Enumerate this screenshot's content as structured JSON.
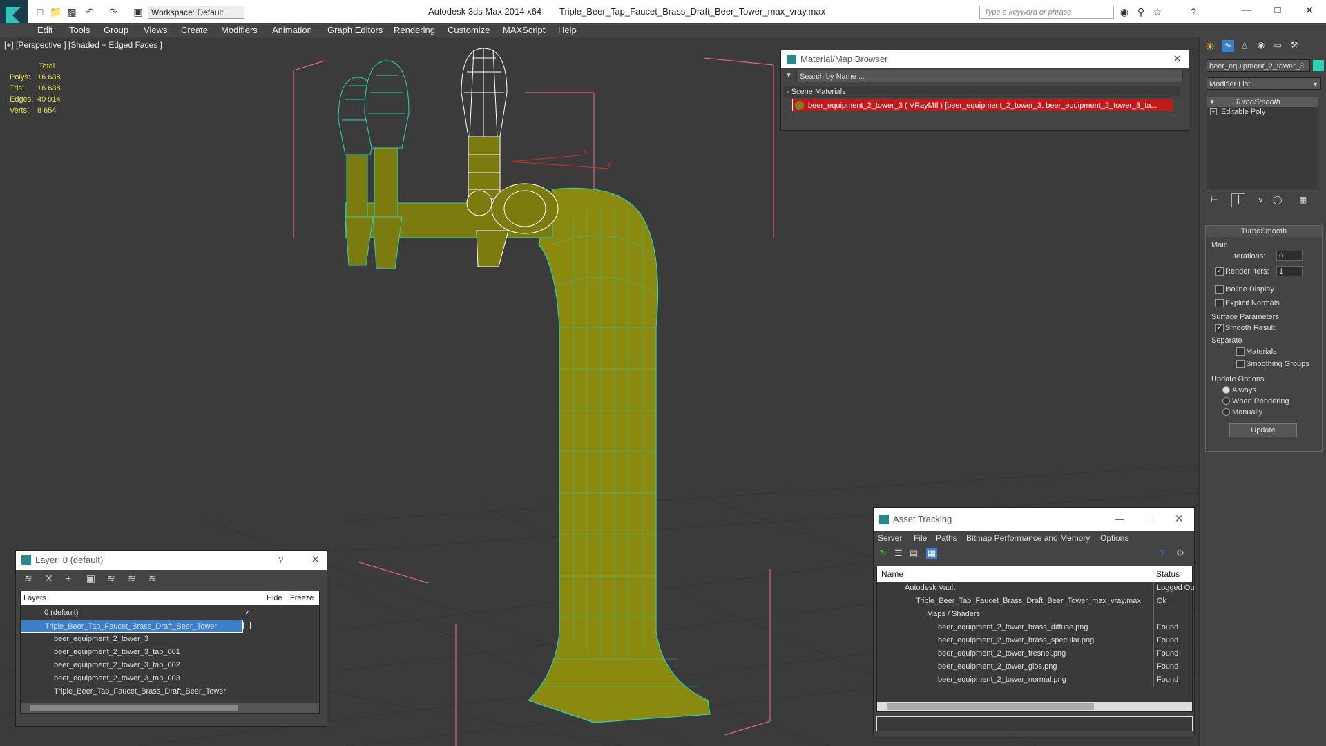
{
  "titlebar": {
    "app_title": "Autodesk 3ds Max  2014 x64",
    "file_title": "Triple_Beer_Tap_Faucet_Brass_Draft_Beer_Tower_max_vray.max",
    "workspace": "Workspace: Default",
    "search_placeholder": "Type a keyword or phrase"
  },
  "menu": [
    "Edit",
    "Tools",
    "Group",
    "Views",
    "Create",
    "Modifiers",
    "Animation",
    "Graph Editors",
    "Rendering",
    "Customize",
    "MAXScript",
    "Help"
  ],
  "viewport": {
    "label": "[+] [Perspective ] [Shaded + Edged Faces ]",
    "stats": {
      "total_label": "Total",
      "rows": [
        {
          "label": "Polys:",
          "value": "16 638"
        },
        {
          "label": "Tris:",
          "value": "16 638"
        },
        {
          "label": "Edges:",
          "value": "49 914"
        },
        {
          "label": "Verts:",
          "value": "8 654"
        }
      ]
    },
    "axis_x": "x",
    "axis_y": "y"
  },
  "material_browser": {
    "title": "Material/Map Browser",
    "search": "Search by Name ...",
    "section": "- Scene Materials",
    "item": "beer_equipment_2_tower_3  ( VRayMtl ) [beer_equipment_2_tower_3, beer_equipment_2_tower_3_ta..."
  },
  "command_panel": {
    "object_name": "beer_equipment_2_tower_3",
    "modifier_list": "Modifier List",
    "stack": [
      "TurboSmooth",
      "Editable Poly"
    ],
    "rollout_title": "TurboSmooth",
    "main_label": "Main",
    "iterations_label": "Iterations:",
    "iterations_value": "0",
    "render_iters_label": "Render Iters:",
    "render_iters_value": "1",
    "isoline": "Isoline Display",
    "explicit_normals": "Explicit Normals",
    "surface_params": "Surface Parameters",
    "smooth_result": "Smooth Result",
    "separate": "Separate",
    "materials": "Materials",
    "smoothing_groups": "Smoothing Groups",
    "update_options": "Update Options",
    "always": "Always",
    "when_rendering": "When Rendering",
    "manually": "Manually",
    "update_button": "Update"
  },
  "layer_dialog": {
    "title": "Layer: 0 (default)",
    "help": "?",
    "col_layers": "Layers",
    "col_hide": "Hide",
    "col_freeze": "Freeze",
    "rows": [
      "0 (default)",
      "Triple_Beer_Tap_Faucet_Brass_Draft_Beer_Tower",
      "beer_equipment_2_tower_3",
      "beer_equipment_2_tower_3_tap_001",
      "beer_equipment_2_tower_3_tap_002",
      "beer_equipment_2_tower_3_tap_003",
      "Triple_Beer_Tap_Faucet_Brass_Draft_Beer_Tower"
    ]
  },
  "asset_dialog": {
    "title": "Asset Tracking",
    "menu": [
      "Server",
      "File",
      "Paths",
      "Bitmap Performance and Memory",
      "Options"
    ],
    "col_name": "Name",
    "col_status": "Status",
    "rows": [
      {
        "name": "Autodesk Vault",
        "status": "Logged Ou"
      },
      {
        "name": "Triple_Beer_Tap_Faucet_Brass_Draft_Beer_Tower_max_vray.max",
        "status": "Ok"
      },
      {
        "name": "Maps / Shaders",
        "status": ""
      },
      {
        "name": "beer_equipment_2_tower_brass_diffuse.png",
        "status": "Found"
      },
      {
        "name": "beer_equipment_2_tower_brass_specular.png",
        "status": "Found"
      },
      {
        "name": "beer_equipment_2_tower_fresnel.png",
        "status": "Found"
      },
      {
        "name": "beer_equipment_2_tower_glos.png",
        "status": "Found"
      },
      {
        "name": "beer_equipment_2_tower_normal.png",
        "status": "Found"
      }
    ]
  },
  "colors": {
    "accent": "#3d7ec8",
    "stats": "#e7e04a",
    "mesh_fill": "#8a8a10",
    "wire": "#2ad3b5",
    "bbox": "#e0608a",
    "selected_wire": "#ffffff",
    "mat_item_bg": "#c21a1a"
  }
}
